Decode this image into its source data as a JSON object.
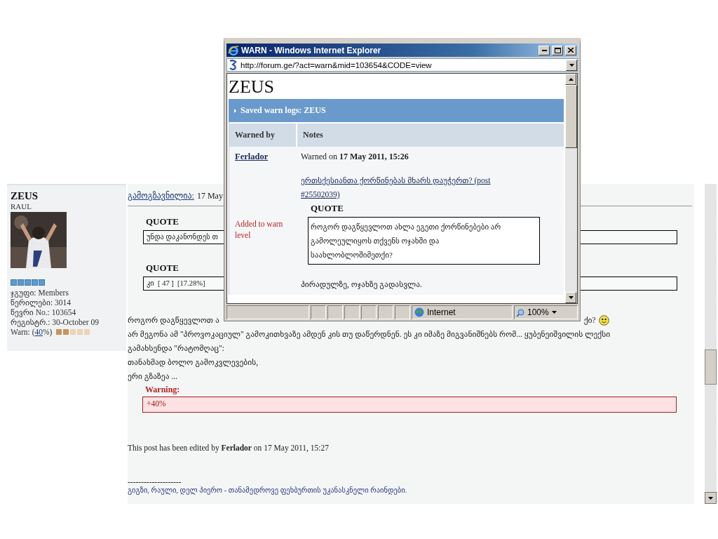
{
  "profile": {
    "name": "ZEUS",
    "title": "RAUL",
    "details": [
      "ჯგუფი: Members",
      "წერილები: 3014",
      "წევრი No.: 103654",
      "რეგისტრ.: 30-October 09"
    ],
    "warn": {
      "prefix": "Warn: (",
      "link": "40",
      "suffix": "%)",
      "level": 0.4
    }
  },
  "post": {
    "header_link": "გამოგზავნილია:",
    "header_date": "17 May",
    "quotes": [
      {
        "label": "QUOTE",
        "text": "უნდა დაკანონდეს თ"
      },
      {
        "label": "QUOTE",
        "text": "კი  [ 47 ]  [17.28%]"
      }
    ],
    "first_line": {
      "left": "როგორ დაგწყევლოთ ა",
      "right": "ქი?"
    },
    "body_lines": [
      "არ მეგონა ამ \"პროვოკაციულ\" გამოკითხვაზე ამდენ კის თუ დაწერდნენ. ეს კი იმაზე მიგვანიშნებს რომ... ყუბენეიშვილის ლექსი",
      "გამახსენდა \"რატომღაც\":",
      "თანახმად ბოლო გამოკვლევების,",
      "ერი გზაზეა ..."
    ],
    "warning": {
      "label": "Warning:",
      "text": "+40%"
    },
    "edit_note": "This post has been edited by **Ferlador** on 17 May 2011, 15:27",
    "signature_rule": "--------------------",
    "signature": "გიგზი, რაული, დელ პიერო - თანამედროვე ფეხბურთის უკანასკნელი რაინდები."
  },
  "popup": {
    "title": "WARN - Windows Internet Explorer",
    "address": "http://forum.ge/?act=warn&mid=103654&CODE=view",
    "heading": "ZEUS",
    "section_title": "Saved warn logs: ZEUS",
    "columns": [
      "Warned by",
      "Notes"
    ],
    "rows": [
      {
        "warned_by": "Ferlador",
        "action": "Added to warn level",
        "date_line": "Warned on **17 May 2011, 15:26**",
        "post_link": "ერთსქესიანთა ქორწინებას მხარს დაუჭერთ? (post #25502039)",
        "quote_label": "QUOTE",
        "quote": "როგორ დაგწყევლოთ ახლა ეგეთი ქორწინებები არ გამოლეულიყოს თქვენს ოჯახში და საახლობლოშიმეთქი?",
        "note": "პირადულზე, ოჯახზე გადასვლა."
      }
    ],
    "status": "Internet",
    "zoom": "100%"
  }
}
